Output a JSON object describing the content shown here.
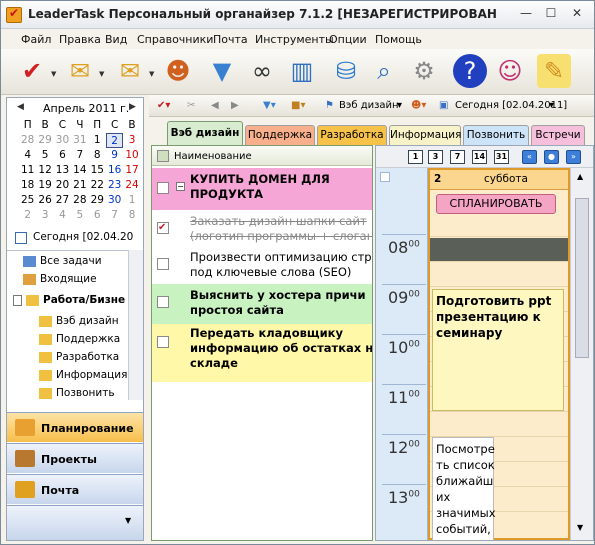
{
  "window": {
    "title": "LeaderTask Персональный органайзер 7.1.2 [НЕЗАРЕГИСТРИРОВАННАЯ КОП...",
    "min": "—",
    "max": "☐",
    "close": "✕"
  },
  "menu": [
    "Файл",
    "Правка",
    "Вид",
    "Справочники",
    "Почта",
    "Инструменты",
    "Опции",
    "Помощь"
  ],
  "calendar": {
    "month": "Апрель 2011 г.",
    "weekdays": [
      "П",
      "В",
      "С",
      "Ч",
      "П",
      "С",
      "В"
    ],
    "weeks": [
      [
        "28",
        "29",
        "30",
        "31",
        "1",
        "2",
        "3"
      ],
      [
        "4",
        "5",
        "6",
        "7",
        "8",
        "9",
        "10"
      ],
      [
        "11",
        "12",
        "13",
        "14",
        "15",
        "16",
        "17"
      ],
      [
        "18",
        "19",
        "20",
        "21",
        "22",
        "23",
        "24"
      ],
      [
        "25",
        "26",
        "27",
        "28",
        "29",
        "30",
        "1"
      ],
      [
        "2",
        "3",
        "4",
        "5",
        "6",
        "7",
        "8"
      ]
    ],
    "today_label": "Сегодня [02.04.20"
  },
  "tree": {
    "all_tasks": "Все задачи",
    "inbox": "Входящие",
    "work": "Работа/Бизне",
    "children": [
      "Вэб дизайн",
      "Поддержка",
      "Разработка",
      "Информация",
      "Позвонить"
    ]
  },
  "nav": {
    "planning": "Планирование",
    "projects": "Проекты",
    "mail": "Почта"
  },
  "toolbar2": {
    "project": "Вэб дизайн",
    "date": "Сегодня [02.04.2011]"
  },
  "tabs": [
    "Вэб дизайн",
    "Поддержка",
    "Разработка",
    "Информация",
    "Позвонить",
    "Встречи"
  ],
  "tasklist": {
    "header": "Наименование",
    "tasks": [
      {
        "text": "КУПИТЬ ДОМЕН ДЛЯ\nПРОДУКТА",
        "color": "#f6a6d6",
        "bold": true,
        "done": false
      },
      {
        "text": "Заказать дизайн шапки сайт\n(логотип программы + слоган",
        "color": "#ffffff",
        "bold": false,
        "done": true
      },
      {
        "text": "Произвести оптимизацию стр\nпод ключевые слова (SEO)",
        "color": "#ffffff",
        "bold": false,
        "done": false
      },
      {
        "text": "Выяснить у хостера причи\nпростоя сайта",
        "color": "#c8f2c0",
        "bold": true,
        "done": false
      },
      {
        "text": "Передать кладовщику\nинформацию об остатках н\nскладе",
        "color": "#fff8a8",
        "bold": true,
        "done": false
      }
    ]
  },
  "dayview": {
    "buttons": [
      "1",
      "3",
      "7",
      "14",
      "31"
    ],
    "day_number": "2",
    "day_name": "суббота",
    "plan_button": "СПЛАНИРОВАТЬ",
    "hours": [
      "08",
      "09",
      "10",
      "11",
      "12",
      "13"
    ],
    "minutes": "00",
    "note1": "Подготовить ppt\nпрезентацию к\nсеминару",
    "note2": "Посмотре\nть список\nближайш\nих\nзначимых\nсобытий,"
  }
}
